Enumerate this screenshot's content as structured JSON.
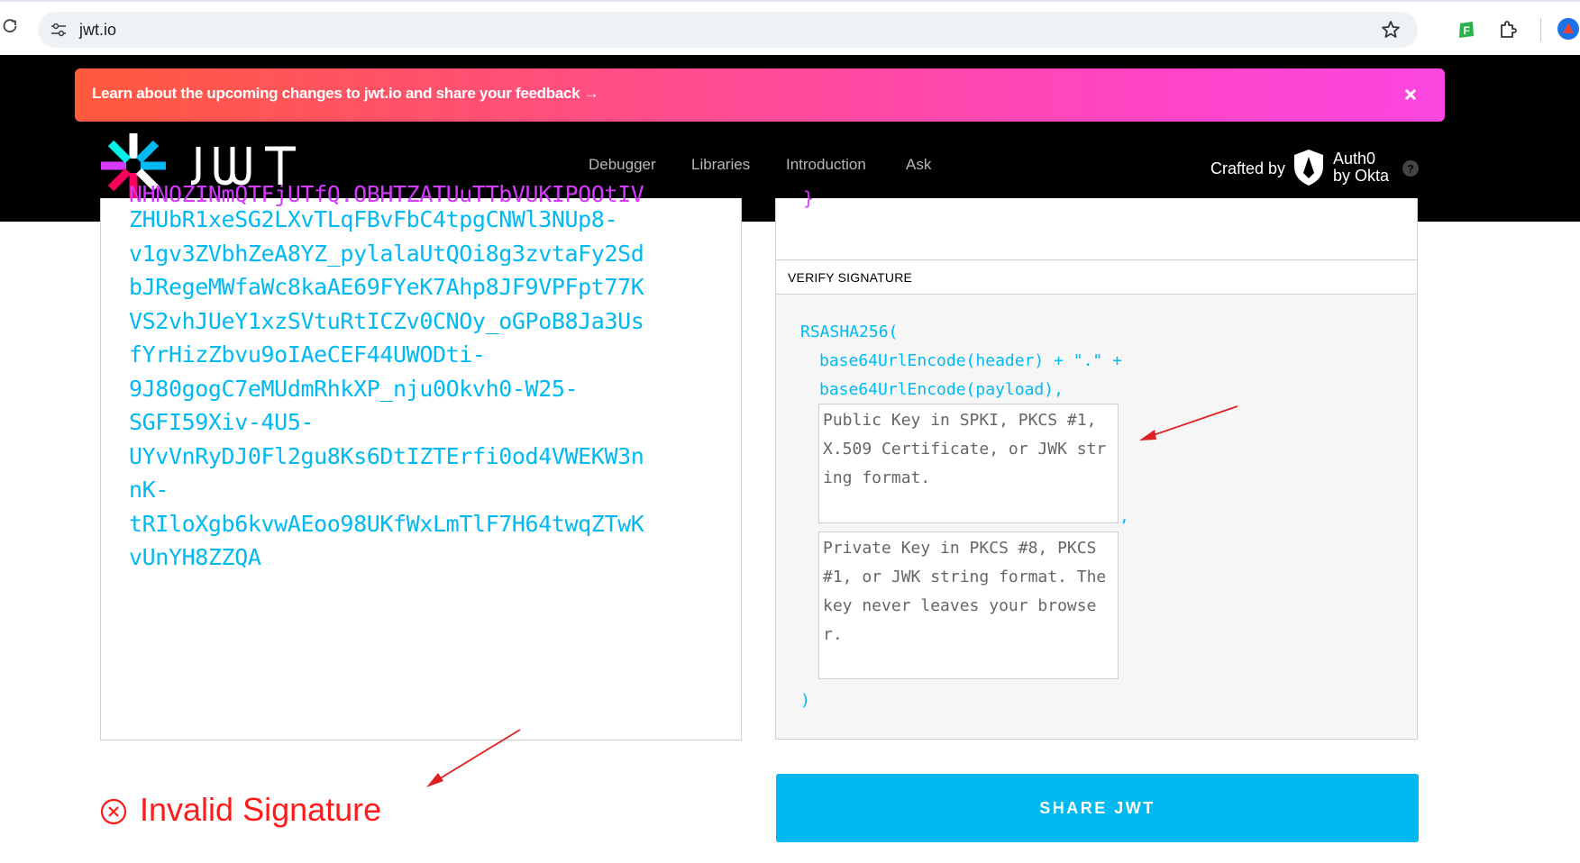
{
  "browser": {
    "url": "jwt.io",
    "icons": [
      "reload-icon",
      "site-info-icon",
      "bookmark-star-icon",
      "extension-f-icon",
      "extensions-puzzle-icon",
      "profile-icon"
    ]
  },
  "banner": {
    "text": "Learn about the upcoming changes to jwt.io and share your feedback",
    "arrow": "→",
    "close_icon": "close-icon",
    "colors": {
      "start": "#ff5a3d",
      "end": "#fb47e0"
    }
  },
  "header": {
    "logo_text": "JWT",
    "nav": [
      "Debugger",
      "Libraries",
      "Introduction",
      "Ask"
    ],
    "crafted_by": "Crafted by",
    "auth0_line1": "Auth0",
    "auth0_line2": "by Okta"
  },
  "encoded": {
    "token_partial_top": "NHNOZINmQTFjUTfQ.OBHTZATUuTTbVUKIPOOtIV",
    "token_lines": [
      "ZHUbR1xeSG2LXvTLqFBvFbC4tpgCNWl3NUp8-",
      "v1gv3ZVbhZeA8YZ_pylalaUtQOi8g3zvtaFy2Sd",
      "bJRegeMWfaWc8kaAE69FYeK7Ahp8JF9VPFpt77K",
      "VS2vhJUeY1xzSVtuRtICZv0CNOy_oGPoB8Ja3Us",
      "fYrHizZbvu9oIAeCEF44UWODti-",
      "9J80gogC7eMUdmRhkXP_nju0Okvh0-W25-",
      "SGFI59Xiv-4U5-",
      "UYvVnRyDJ0Fl2gu8Ks6DtIZTErfi0od4VWEKW3n",
      "nK-",
      "tRIloXgb6kvwAEoo98UKfWxLmTlF7H64twqZTwK",
      "vUnYH8ZZQA"
    ],
    "colors": {
      "header": "#fb015b",
      "payload": "#d63aff",
      "signature": "#00b9f1"
    }
  },
  "status": {
    "text": "Invalid Signature",
    "icon": "error-circle-x-icon",
    "color": "#ff1a1a"
  },
  "payload_tail": "}",
  "verify": {
    "title": "VERIFY SIGNATURE",
    "algo_line": "RSASHA256(",
    "line2": "base64UrlEncode(header) + \".\" +",
    "line3": "base64UrlEncode(payload),",
    "public_key_placeholder": "Public Key in SPKI, PKCS #1, X.509 Certificate, or JWK string format.",
    "private_key_placeholder": "Private Key in PKCS #8, PKCS #1, or JWK string format. The key never leaves your browser.",
    "comma": ",",
    "close": ")"
  },
  "share_button": {
    "label": "SHARE JWT",
    "color": "#00b9f1"
  },
  "annotations": {
    "arrow_color": "#e02020"
  }
}
